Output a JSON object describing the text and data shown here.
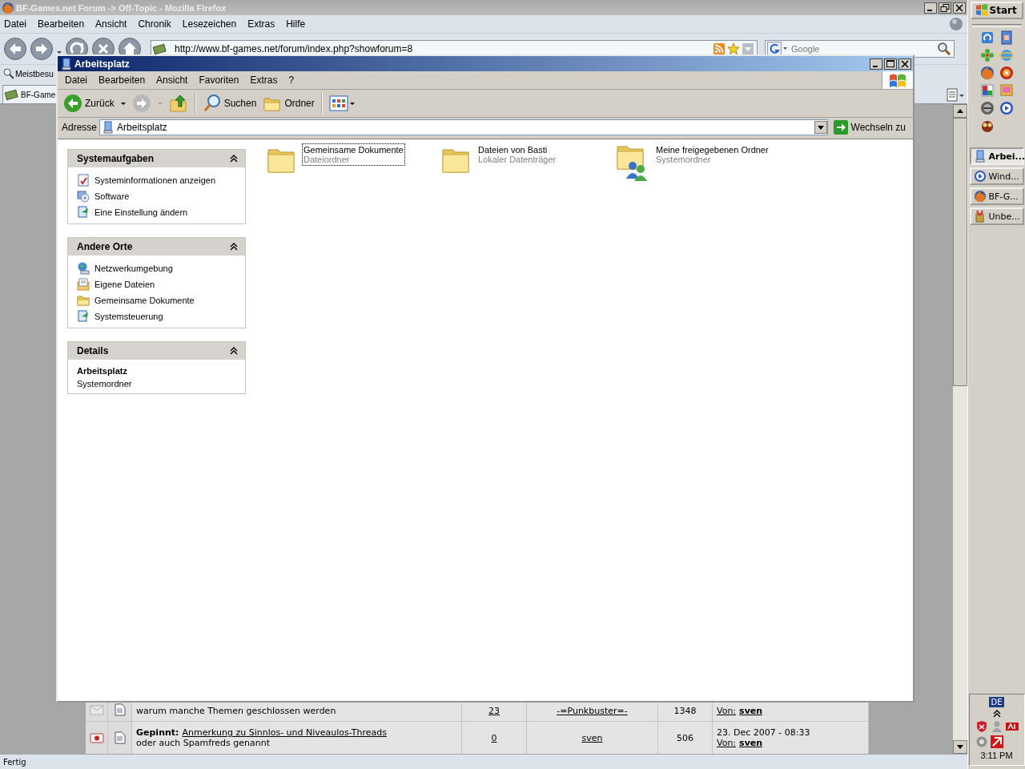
{
  "browser": {
    "title": "BF-Games.net Forum -> Off-Topic - Mozilla Firefox",
    "menu": [
      "Datei",
      "Bearbeiten",
      "Ansicht",
      "Chronik",
      "Lesezeichen",
      "Extras",
      "Hilfe"
    ],
    "url": "http://www.bf-games.net/forum/index.php?showforum=8",
    "search": {
      "placeholder": "Google"
    },
    "bookmarks": [
      "Meistbesu"
    ],
    "tabs": [
      {
        "label": "BF-Game",
        "selected": true
      }
    ],
    "forum_rows": [
      {
        "kind": "closed",
        "topic_description": "warum manche Themen geschlossen werden",
        "replies": "23",
        "starter": "-=Punkbuster=-",
        "views": "1348",
        "last_post_prefix": "Von:",
        "last_post_author": "sven"
      },
      {
        "kind": "pinned",
        "topic_prefix": "Gepinnt:",
        "topic_title": "Anmerkung zu Sinnlos- und Niveaulos-Threads",
        "topic_description": "oder auch Spamfreds genannt",
        "replies": "0",
        "starter": "sven",
        "views": "506",
        "last_post_date": "23. Dec 2007 - 08:33",
        "last_post_prefix": "Von:",
        "last_post_author": "sven"
      }
    ],
    "status": "Fertig"
  },
  "explorer": {
    "title": "Arbeitsplatz",
    "menu": [
      "Datei",
      "Bearbeiten",
      "Ansicht",
      "Favoriten",
      "Extras",
      "?"
    ],
    "toolbar": [
      {
        "kind": "back",
        "label": "Zurück",
        "disabled": false
      },
      {
        "kind": "forward",
        "disabled": true
      },
      {
        "kind": "up"
      },
      {
        "kind": "search",
        "label": "Suchen"
      },
      {
        "kind": "folders",
        "label": "Ordner"
      },
      {
        "kind": "views"
      }
    ],
    "address_label": "Adresse",
    "address": "Arbeitsplatz",
    "go": "Wechseln zu",
    "panels": [
      {
        "kind": "links",
        "title": "Systemaufgaben",
        "expanded": true,
        "items": [
          {
            "kind": "sysinfo",
            "label": "Systeminformationen anzeigen"
          },
          {
            "kind": "software",
            "label": "Software"
          },
          {
            "kind": "control",
            "label": "Eine Einstellung ändern"
          }
        ]
      },
      {
        "kind": "links",
        "title": "Andere Orte",
        "expanded": true,
        "items": [
          {
            "kind": "network",
            "label": "Netzwerkumgebung"
          },
          {
            "kind": "documents",
            "label": "Eigene Dateien"
          },
          {
            "kind": "folder",
            "label": "Gemeinsame Dokumente"
          },
          {
            "kind": "control",
            "label": "Systemsteuerung"
          }
        ]
      },
      {
        "kind": "details",
        "title": "Details",
        "expanded": true,
        "name": "Arbeitsplatz",
        "type": "Systemordner"
      }
    ],
    "items": [
      {
        "kind": "folder",
        "name": "Gemeinsame Dokumente",
        "type": "Dateiordner",
        "selected": true
      },
      {
        "kind": "folder",
        "name": "Dateien von Basti",
        "type": "Lokaler Datenträger",
        "selected": false
      },
      {
        "kind": "shared",
        "name": "Meine freigegebenen Ordner",
        "type": "Systemordner",
        "selected": false
      }
    ]
  },
  "taskbar": {
    "start": "Start",
    "tasks": [
      {
        "kind": "computer",
        "label": "Arbei...",
        "selected": true
      },
      {
        "kind": "media",
        "label": "Wind...",
        "selected": false
      },
      {
        "kind": "firefox",
        "label": "BF-G...",
        "selected": false
      },
      {
        "kind": "paint",
        "label": "Unbe...",
        "selected": false
      }
    ],
    "language": "DE",
    "clock": "3:11 PM"
  }
}
